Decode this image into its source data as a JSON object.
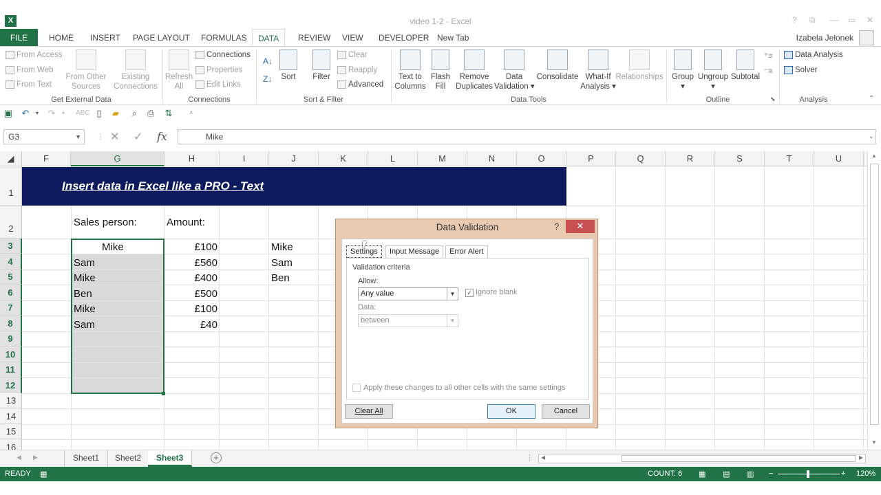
{
  "window": {
    "title": "video 1-2 - Excel",
    "controls": [
      "?",
      "⧉",
      "—",
      "▭",
      "✕"
    ]
  },
  "ribbon_tabs": [
    "FILE",
    "HOME",
    "INSERT",
    "PAGE LAYOUT",
    "FORMULAS",
    "DATA",
    "REVIEW",
    "VIEW",
    "DEVELOPER",
    "New Tab"
  ],
  "active_tab": "DATA",
  "account": {
    "user": "Izabela Jelonek"
  },
  "ribbon": {
    "get_external_data": {
      "label": "Get External Data",
      "from_access": "From Access",
      "from_web": "From Web",
      "from_text": "From Text",
      "from_other_1": "From Other",
      "from_other_2": "Sources",
      "existing_1": "Existing",
      "existing_2": "Connections"
    },
    "connections": {
      "label": "Connections",
      "refresh_1": "Refresh",
      "refresh_2": "All",
      "connections": "Connections",
      "properties": "Properties",
      "edit_links": "Edit Links"
    },
    "sort_filter": {
      "label": "Sort & Filter",
      "sort": "Sort",
      "filter": "Filter",
      "clear": "Clear",
      "reapply": "Reapply",
      "advanced": "Advanced"
    },
    "data_tools": {
      "label": "Data Tools",
      "text_to_1": "Text to",
      "text_to_2": "Columns",
      "flash_1": "Flash",
      "flash_2": "Fill",
      "remove_1": "Remove",
      "remove_2": "Duplicates",
      "validation_1": "Data",
      "validation_2": "Validation",
      "consolidate": "Consolidate",
      "whatif_1": "What-If",
      "whatif_2": "Analysis",
      "relationships": "Relationships"
    },
    "outline": {
      "label": "Outline",
      "group": "Group",
      "ungroup": "Ungroup",
      "subtotal": "Subtotal"
    },
    "analysis": {
      "label": "Analysis",
      "data_analysis": "Data Analysis",
      "solver": "Solver"
    }
  },
  "formula_bar": {
    "name_box": "G3",
    "fx": "fx",
    "content": "Mike"
  },
  "columns": [
    "F",
    "G",
    "H",
    "I",
    "J",
    "K",
    "L",
    "M",
    "N",
    "O",
    "P",
    "Q",
    "R",
    "S",
    "T",
    "U"
  ],
  "rows": [
    "1",
    "2",
    "3",
    "4",
    "5",
    "6",
    "7",
    "8",
    "9",
    "10",
    "11",
    "12",
    "13",
    "14",
    "15",
    "16"
  ],
  "sheet": {
    "banner": "Insert data in Excel like a PRO - Text",
    "sales_header": "Sales person:",
    "amount_header": "Amount:",
    "sales": [
      "Mike",
      "Sam",
      "Mike",
      "Ben",
      "Mike",
      "Sam"
    ],
    "amounts": [
      "£100",
      "£560",
      "£400",
      "£500",
      "£100",
      "£40"
    ],
    "list": [
      "Mike",
      "Sam",
      "Ben"
    ]
  },
  "sheet_tabs": [
    "Sheet1",
    "Sheet2",
    "Sheet3"
  ],
  "active_sheet": "Sheet3",
  "status": {
    "ready": "READY",
    "count": "COUNT: 6",
    "zoom": "120%"
  },
  "dialog": {
    "title": "Data Validation",
    "help": "?",
    "close": "✕",
    "tabs": [
      "Settings",
      "Input Message",
      "Error Alert"
    ],
    "section": "Validation criteria",
    "allow_label": "Allow:",
    "allow_value": "Any value",
    "ignore_blank": "Ignore blank",
    "data_label": "Data:",
    "data_value": "between",
    "apply_all": "Apply these changes to all other cells with the same settings",
    "clear_all": "Clear All",
    "ok": "OK",
    "cancel": "Cancel"
  },
  "colors": {
    "excel_green": "#217346",
    "banner_navy": "#0e1a5e",
    "dialog_frame": "#e8c9b1",
    "close_red": "#c75050"
  }
}
